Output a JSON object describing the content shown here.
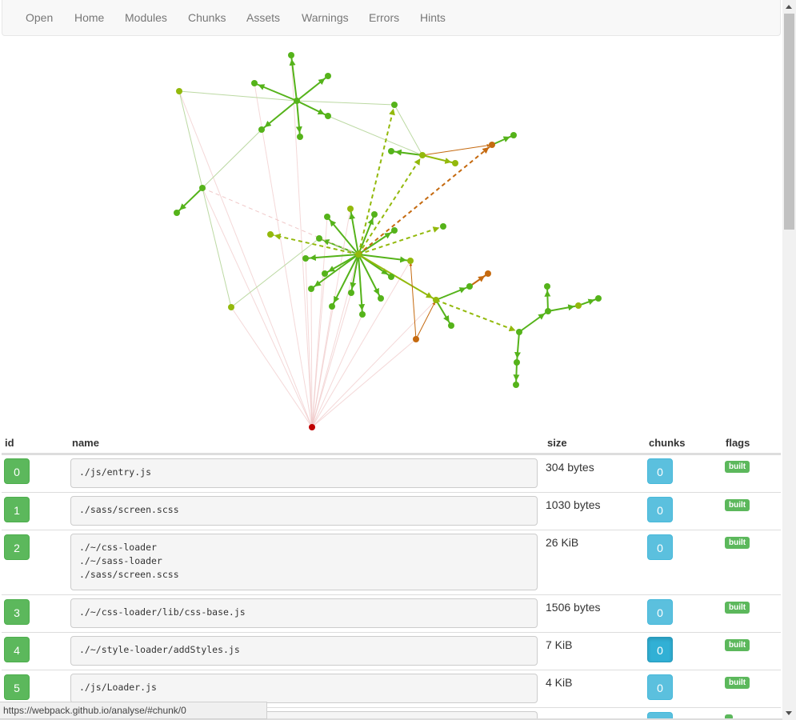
{
  "nav": [
    "Open",
    "Home",
    "Modules",
    "Chunks",
    "Assets",
    "Warnings",
    "Errors",
    "Hints"
  ],
  "table": {
    "headers": [
      "id",
      "name",
      "size",
      "chunks",
      "flags"
    ],
    "rows": [
      {
        "id": "0",
        "name": "./js/entry.js",
        "size": "304 bytes",
        "chunk": "0",
        "flag": "built"
      },
      {
        "id": "1",
        "name": "./sass/screen.scss",
        "size": "1030 bytes",
        "chunk": "0",
        "flag": "built"
      },
      {
        "id": "2",
        "name": "./~/css-loader\n./~/sass-loader\n./sass/screen.scss",
        "size": "26 KiB",
        "chunk": "0",
        "flag": "built"
      },
      {
        "id": "3",
        "name": "./~/css-loader/lib/css-base.js",
        "size": "1506 bytes",
        "chunk": "0",
        "flag": "built"
      },
      {
        "id": "4",
        "name": "./~/style-loader/addStyles.js",
        "size": "7 KiB",
        "chunk": "0",
        "flag": "built"
      },
      {
        "id": "5",
        "name": "./js/Loader.js",
        "size": "4 KiB",
        "chunk": "0",
        "flag": "built"
      }
    ]
  },
  "status_url": "https://webpack.github.io/analyse/#chunk/0",
  "colors": {
    "success": "#5cb85c",
    "info": "#5bc0de",
    "edge_green": "#55b31a",
    "node_root": "#c00000"
  }
}
